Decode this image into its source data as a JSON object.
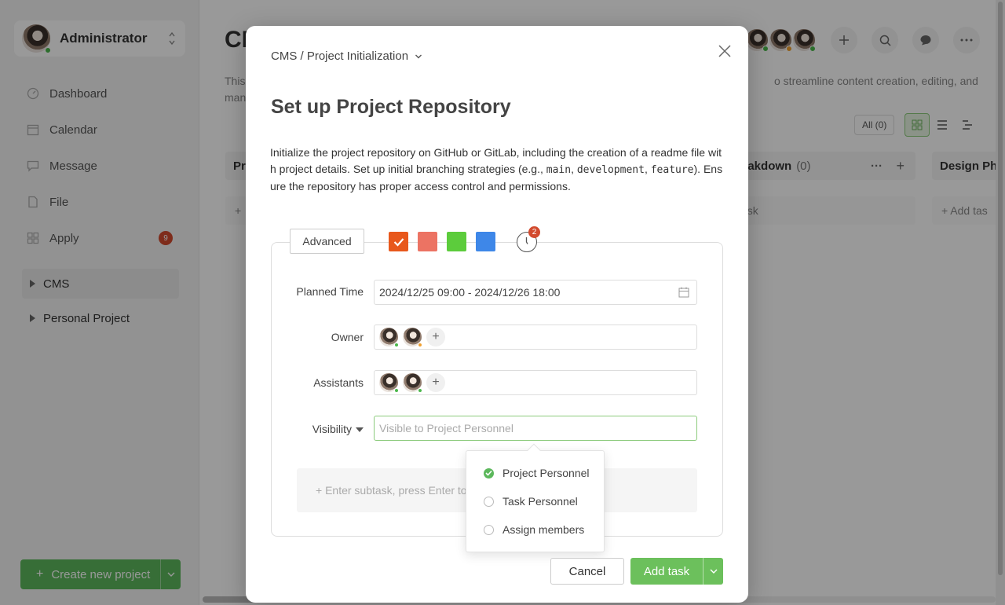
{
  "sidebar": {
    "user_name": "Administrator",
    "nav": [
      {
        "label": "Dashboard",
        "icon": "dashboard-icon"
      },
      {
        "label": "Calendar",
        "icon": "calendar-icon"
      },
      {
        "label": "Message",
        "icon": "message-icon"
      },
      {
        "label": "File",
        "icon": "file-icon"
      },
      {
        "label": "Apply",
        "icon": "apply-icon",
        "badge": "9"
      }
    ],
    "projects": [
      {
        "label": "CMS",
        "active": true
      },
      {
        "label": "Personal Project",
        "active": false
      }
    ],
    "create_label": "Create new project"
  },
  "main": {
    "title": "CMS",
    "desc_left": "This",
    "desc_left2": "man",
    "desc_right": "o streamline content creation, editing, and",
    "filter_all": "All (0)",
    "columns": [
      {
        "title": "Pr",
        "add": "+"
      },
      {
        "title": "eakdown",
        "count": "(0)",
        "add": "ask"
      },
      {
        "title": "Design Ph",
        "add": "+ Add tas"
      }
    ]
  },
  "modal": {
    "breadcrumb": "CMS / Project Initialization",
    "title": "Set up Project Repository",
    "desc_part1": "Initialize the project repository on GitHub or GitLab, including the creation of a readme file with project details. Set up initial branching strategies (e.g., ",
    "code1": "main",
    "sep1": ", ",
    "code2": "development",
    "sep2": ", ",
    "code3": "feature",
    "desc_part2": "). Ensure the repository has proper access control and permissions.",
    "advanced_label": "Advanced",
    "colors": [
      "#e8581c",
      "#ec7363",
      "#5ccc3c",
      "#3e87e8"
    ],
    "clock_badge": "2",
    "fields": {
      "planned_time_label": "Planned Time",
      "planned_time_value": "2024/12/25 09:00 - 2024/12/26 18:00",
      "owner_label": "Owner",
      "assistants_label": "Assistants",
      "visibility_label": "Visibility",
      "visibility_placeholder": "Visible to Project Personnel"
    },
    "subtask_placeholder": "+ Enter subtask, press Enter to",
    "dropdown": [
      {
        "label": "Project Personnel",
        "checked": true
      },
      {
        "label": "Task Personnel",
        "checked": false
      },
      {
        "label": "Assign members",
        "checked": false
      }
    ],
    "cancel_label": "Cancel",
    "add_task_label": "Add task"
  }
}
